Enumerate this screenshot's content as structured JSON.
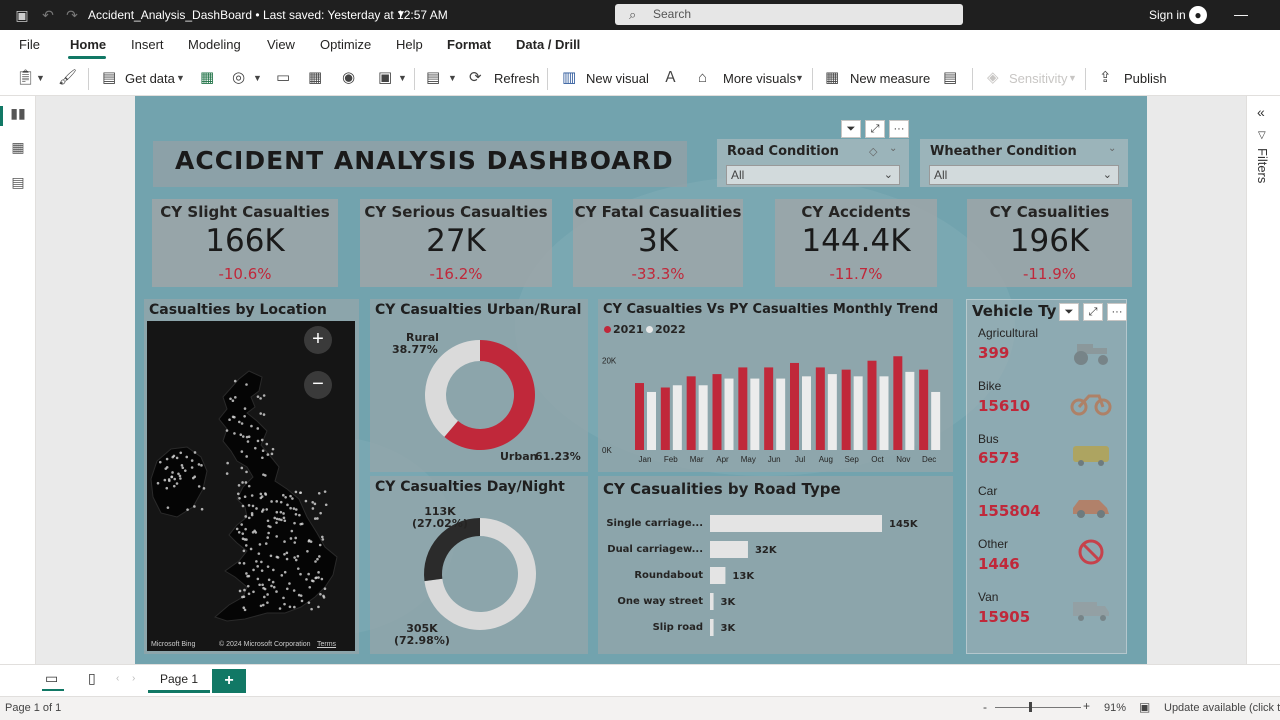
{
  "titlebar": {
    "doc_title": "Accident_Analysis_DashBoard • Last saved: Yesterday at 12:57 AM",
    "search_placeholder": "Search",
    "signin": "Sign in"
  },
  "menu": [
    "File",
    "Home",
    "Insert",
    "Modeling",
    "View",
    "Optimize",
    "Help",
    "Format",
    "Data / Drill"
  ],
  "ribbon": {
    "get_data": "Get data",
    "refresh": "Refresh",
    "new_visual": "New visual",
    "more_visuals": "More visuals",
    "new_measure": "New measure",
    "sensitivity": "Sensitivity",
    "publish": "Publish"
  },
  "rightrail": {
    "filters": "Filters"
  },
  "dashboard": {
    "title": "ACCIDENT ANALYSIS DASHBOARD",
    "slicers": [
      {
        "title": "Road Condition",
        "value": "All"
      },
      {
        "title": "Wheather Condition",
        "value": "All"
      }
    ],
    "kpis": [
      {
        "title": "CY Slight Casualties",
        "value": "166K",
        "delta": "-10.6%"
      },
      {
        "title": "CY Serious Casualties",
        "value": "27K",
        "delta": "-16.2%"
      },
      {
        "title": "CY Fatal Casualities",
        "value": "3K",
        "delta": "-33.3%"
      },
      {
        "title": "CY Accidents",
        "value": "144.4K",
        "delta": "-11.7%"
      },
      {
        "title": "CY Casualities",
        "value": "196K",
        "delta": "-11.9%"
      }
    ],
    "map": {
      "title": "Casualties by Location",
      "zoom_in": "+",
      "zoom_out": "−",
      "attribution_logo": "Microsoft Bing",
      "attribution": "© 2024 Microsoft Corporation",
      "terms": "Terms"
    },
    "vehicle": {
      "title": "Vehicle Ty",
      "items": [
        {
          "name": "Agricultural",
          "value": "399",
          "icon": "tractor-icon"
        },
        {
          "name": "Bike",
          "value": "15610",
          "icon": "bike-icon"
        },
        {
          "name": "Bus",
          "value": "6573",
          "icon": "bus-icon"
        },
        {
          "name": "Car",
          "value": "155804",
          "icon": "car-icon"
        },
        {
          "name": "Other",
          "value": "1446",
          "icon": "prohibited-icon"
        },
        {
          "name": "Van",
          "value": "15905",
          "icon": "truck-icon"
        }
      ]
    },
    "colors": {
      "accent_red": "#c0283a",
      "light_gray": "#dadada",
      "dark": "#2b2b2b",
      "report_bg": "#72a3ae"
    }
  },
  "chart_data": [
    {
      "type": "pie",
      "title": "CY Casualties Urban/Rural",
      "donut": true,
      "labels": [
        "Rural",
        "Urban"
      ],
      "values": [
        38.77,
        61.23
      ],
      "value_labels": [
        "38.77%",
        "61.23%"
      ]
    },
    {
      "type": "pie",
      "title": "CY Casualties Day/Night",
      "donut": true,
      "labels": [
        "",
        ""
      ],
      "values": [
        27.02,
        72.98
      ],
      "value_labels": [
        "113K\n(27.02%)",
        "305K\n(72.98%)"
      ]
    },
    {
      "type": "bar",
      "title": "CY Casualties Vs PY Casualties Monthly Trend",
      "categories": [
        "Jan",
        "Feb",
        "Mar",
        "Apr",
        "May",
        "Jun",
        "Jul",
        "Aug",
        "Sep",
        "Oct",
        "Nov",
        "Dec"
      ],
      "series": [
        {
          "name": "2021",
          "values": [
            15.0,
            14.0,
            16.5,
            17.0,
            18.5,
            18.5,
            19.5,
            18.5,
            18.0,
            20.0,
            21.0,
            18.0
          ]
        },
        {
          "name": "2022",
          "values": [
            13.0,
            14.5,
            14.5,
            16.0,
            16.0,
            16.0,
            16.5,
            17.0,
            16.5,
            16.5,
            17.5,
            13.0
          ]
        }
      ],
      "y_ticks": [
        "0K",
        "20K"
      ],
      "ylim": [
        0,
        28
      ],
      "legend": "top-left"
    },
    {
      "type": "bar",
      "orientation": "horizontal",
      "title": "CY Casualities by Road Type",
      "categories": [
        "Single carriage...",
        "Dual carriagew...",
        "Roundabout",
        "One way street",
        "Slip road"
      ],
      "values": [
        145,
        32,
        13,
        3,
        3
      ],
      "value_labels": [
        "145K",
        "32K",
        "13K",
        "3K",
        "3K"
      ]
    }
  ],
  "bottombar": {
    "page_tab": "Page 1",
    "add_page": "+"
  },
  "statusbar": {
    "page_info": "Page 1 of 1",
    "zoom": "91%",
    "update": "Update available (click to"
  }
}
